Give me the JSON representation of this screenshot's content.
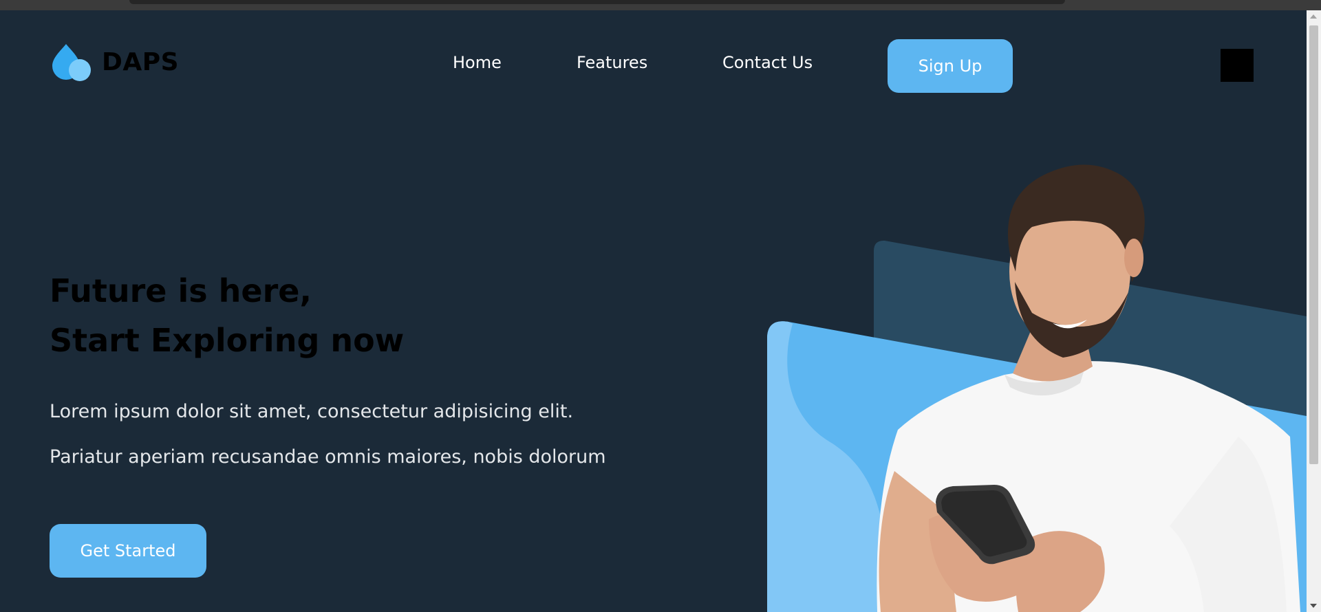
{
  "brand": {
    "name": "DAPS",
    "color": "#5db6f1"
  },
  "nav": {
    "home": "Home",
    "features": "Features",
    "contact": "Contact Us",
    "signup": "Sign Up"
  },
  "hero": {
    "title_line1": "Future is here,",
    "title_line2": "Start Exploring now",
    "para1": "Lorem ipsum dolor sit amet, consectetur adipisicing elit.",
    "para2": "Pariatur aperiam recusandae omnis maiores, nobis dolorum",
    "cta": "Get Started"
  },
  "colors": {
    "background": "#1b2a38",
    "accent": "#5db6f1",
    "panel_dark": "#294b62"
  },
  "icons": {
    "logo": "droplets-icon",
    "menu": "menu-square-icon"
  }
}
